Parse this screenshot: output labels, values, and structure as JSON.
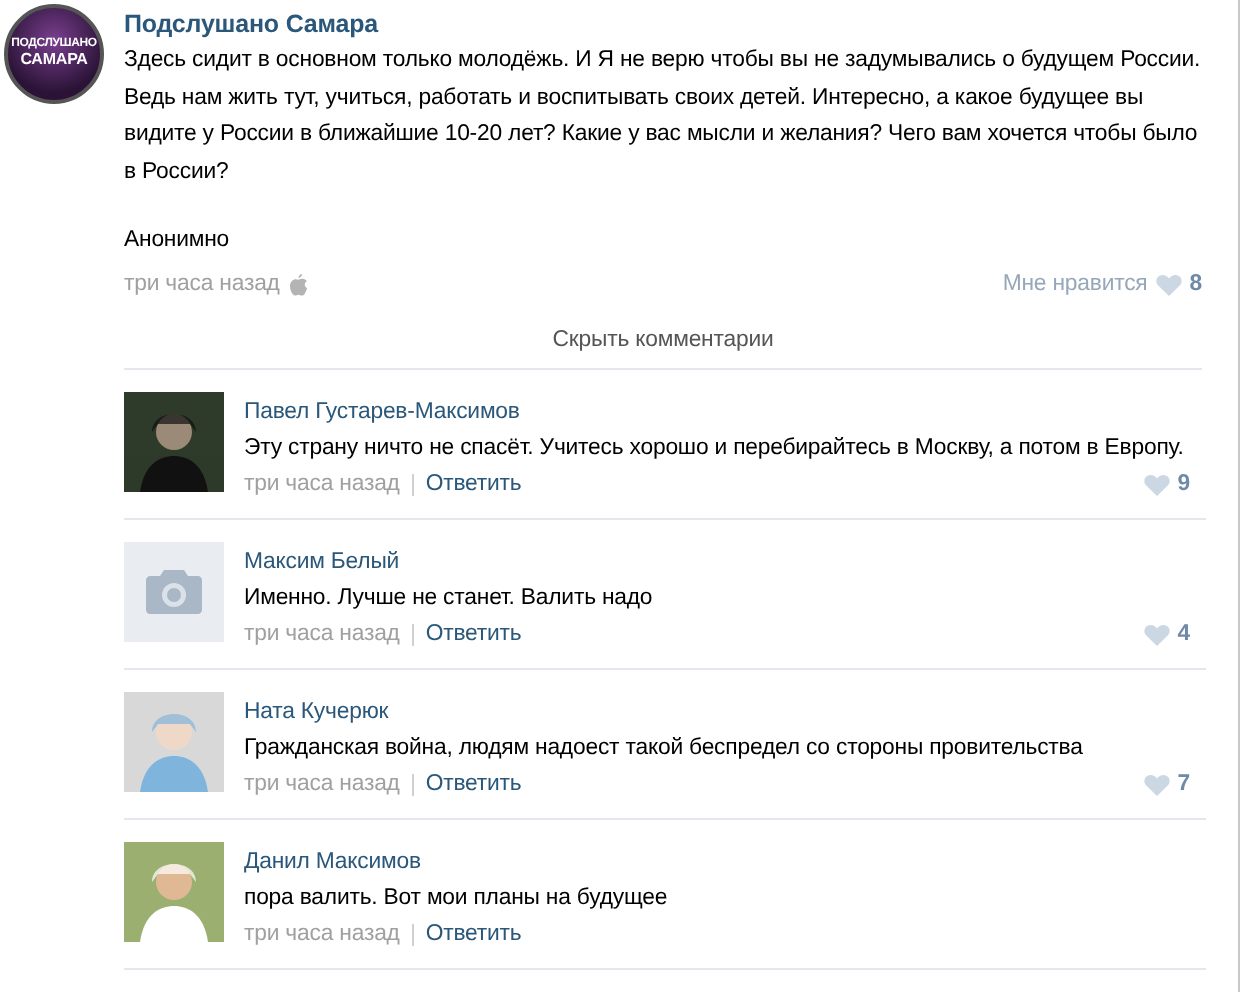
{
  "post": {
    "author": "Подслушано Самара",
    "logo_lines": [
      "ПОДСЛУШАНО",
      "САМАРА"
    ],
    "text": "Здесь сидит в основном только молодёжь. И Я не верю чтобы вы не задумывались о будущем России. Ведь нам жить тут, учиться, работать и воспитывать своих детей. Интересно, а какое будущее вы видите у России в ближайшие 10-20 лет? Какие у вас мысли и желания? Чего вам хочется чтобы было в России?",
    "signature": "Анонимно",
    "time": "три часа назад",
    "like_label": "Мне нравится",
    "likes": "8"
  },
  "hide_comments": "Скрыть комментарии",
  "comments": [
    {
      "author": "Павел Густарев-Максимов",
      "text": "Эту страну ничто не спасёт. Учитесь хорошо и перебирайтесь в Москву, а потом в Европу.",
      "time": "три часа назад",
      "reply": "Ответить",
      "likes": "9"
    },
    {
      "avatar": {
        "kind": "placeholder"
      },
      "author": "Максим Белый",
      "text": "Именно. Лучше не станет. Валить надо",
      "time": "три часа назад",
      "reply": "Ответить",
      "likes": "4"
    },
    {
      "author": "Ната Кучерюк",
      "text": "Гражданская война, людям надоест такой беспредел со стороны провительства",
      "time": "три часа назад",
      "reply": "Ответить",
      "likes": "7"
    },
    {
      "author": "Данил Максимов",
      "text": "пора валить. Вот мои планы на будущее",
      "time": "три часа назад",
      "reply": "Ответить"
    }
  ]
}
